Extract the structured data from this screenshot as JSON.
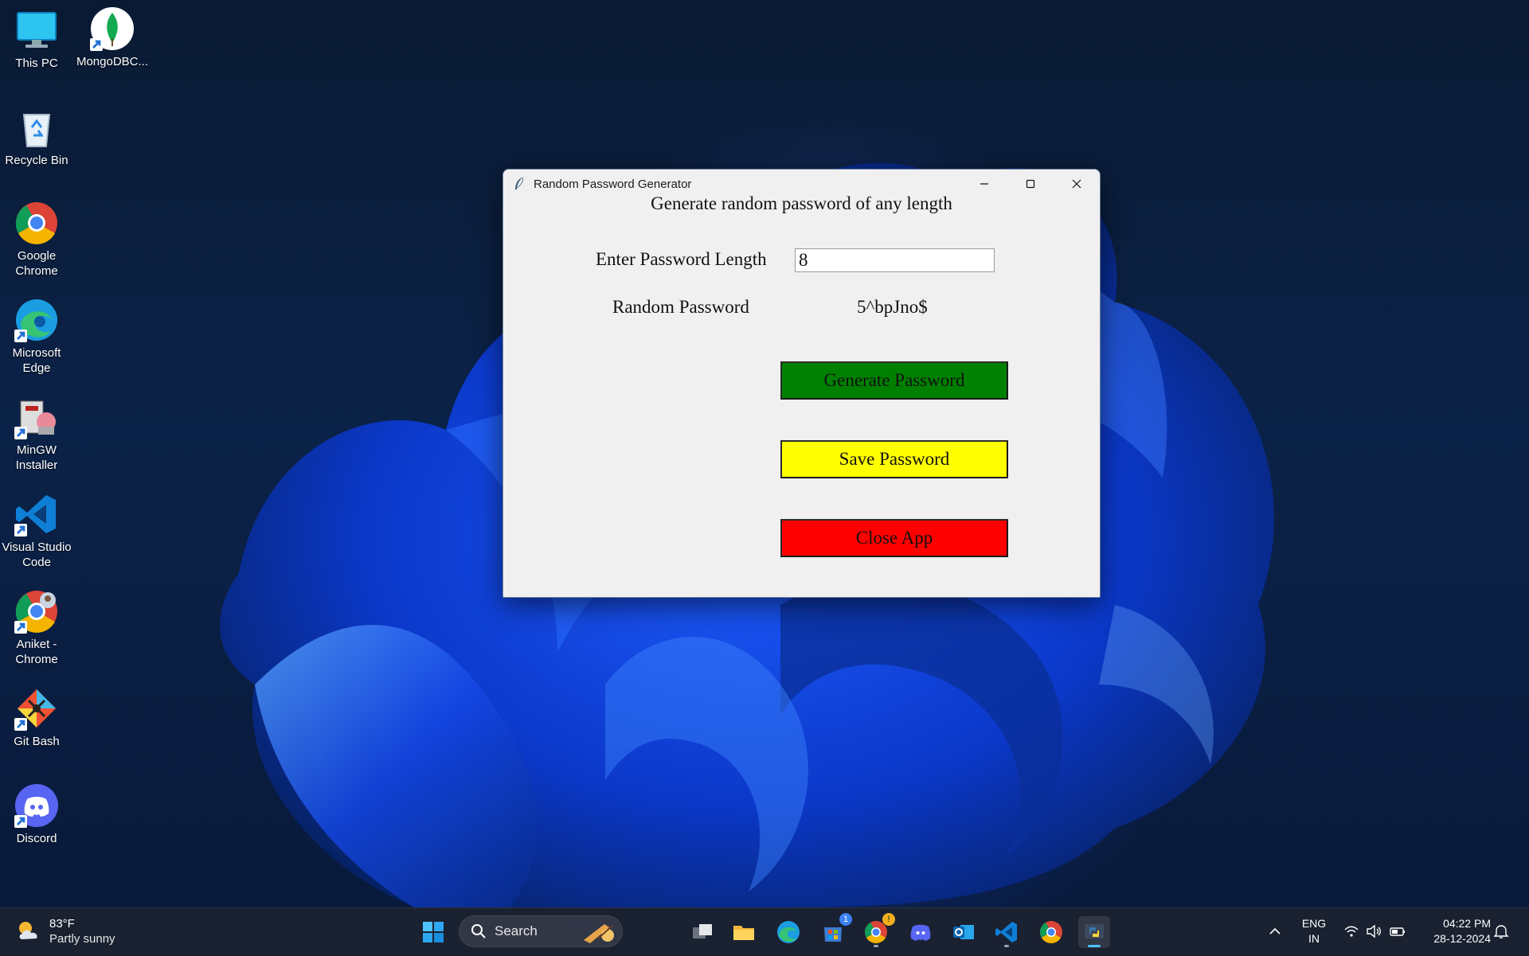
{
  "desktop": {
    "icons": [
      {
        "label": "This PC",
        "icon": "monitor-icon"
      },
      {
        "label": "MongoDBC...",
        "icon": "mongodb-compass-icon"
      },
      {
        "label": "Recycle Bin",
        "icon": "recycle-bin-icon"
      },
      {
        "label": "Google Chrome",
        "icon": "chrome-icon"
      },
      {
        "label": "Microsoft Edge",
        "icon": "edge-icon"
      },
      {
        "label": "MinGW Installer",
        "icon": "mingw-installer-icon"
      },
      {
        "label": "Visual Studio Code",
        "icon": "vscode-icon"
      },
      {
        "label": "Aniket - Chrome",
        "icon": "chrome-profile-icon"
      },
      {
        "label": "Git Bash",
        "icon": "git-bash-icon"
      },
      {
        "label": "Discord",
        "icon": "discord-icon"
      }
    ]
  },
  "window": {
    "title": "Random Password Generator",
    "heading": "Generate random password of any length",
    "length_label": "Enter Password Length",
    "length_value": "8",
    "password_label": "Random Password",
    "password_value": "5^bpJno$",
    "generate_label": "Generate Password",
    "save_label": "Save Password",
    "close_label": "Close App",
    "colors": {
      "generate": "#008000",
      "save": "#ffff00",
      "close": "#ff0000"
    }
  },
  "taskbar": {
    "weather_temp": "83°F",
    "weather_desc": "Partly sunny",
    "search_label": "Search",
    "pinned": [
      "start-icon",
      "task-view-icon",
      "file-explorer-icon",
      "edge-icon",
      "microsoft-store-icon",
      "chrome-icon",
      "discord-icon",
      "outlook-icon",
      "vscode-icon",
      "chrome-icon",
      "python-icon"
    ],
    "store_badge": "1",
    "lang_line1": "ENG",
    "lang_line2": "IN",
    "time": "04:22 PM",
    "date": "28-12-2024"
  }
}
